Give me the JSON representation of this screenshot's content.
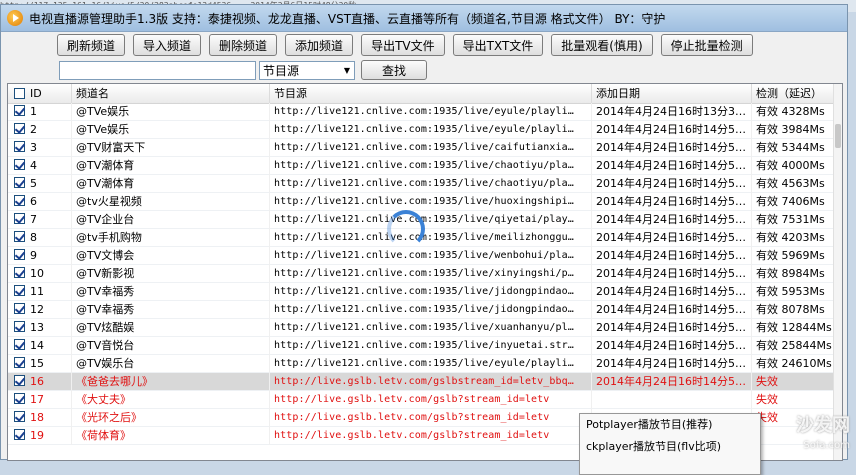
{
  "background_strip": "http://117.135.161.16/live/5/30/283abcefe13d4536... 2014年2月6日15时48分20秒",
  "window": {
    "title": "电视直播源管理助手1.3版  支持：泰捷视频、龙龙直播、VST直播、云直播等所有（频道名,节目源  格式文件） BY：守护"
  },
  "toolbar": {
    "buttons": [
      "刷新频道",
      "导入频道",
      "删除频道",
      "添加频道",
      "导出TV文件",
      "导出TXT文件",
      "批量观看(慎用)",
      "停止批量检测"
    ]
  },
  "search": {
    "value": "",
    "select_value": "节目源",
    "find_label": "查找"
  },
  "table": {
    "columns": [
      "ID",
      "频道名",
      "节目源",
      "添加日期",
      "检测（延迟）"
    ],
    "rows": [
      {
        "checked": true,
        "id": "1",
        "name": "@TVe娱乐",
        "src": "http://live121.cnlive.com:1935/live/eyule/playli…",
        "date": "2014年4月24日16时13分3…",
        "status": "有效  4328Ms",
        "red": false
      },
      {
        "checked": true,
        "id": "2",
        "name": "@TVe娱乐",
        "src": "http://live121.cnlive.com:1935/live/eyule/playli…",
        "date": "2014年4月24日16时14分5…",
        "status": "有效  3984Ms",
        "red": false
      },
      {
        "checked": true,
        "id": "3",
        "name": "@TV财富天下",
        "src": "http://live121.cnlive.com:1935/live/caifutianxia…",
        "date": "2014年4月24日16时14分5…",
        "status": "有效  5344Ms",
        "red": false
      },
      {
        "checked": true,
        "id": "4",
        "name": "@TV潮体育",
        "src": "http://live121.cnlive.com:1935/live/chaotiyu/pla…",
        "date": "2014年4月24日16时14分5…",
        "status": "有效  4000Ms",
        "red": false
      },
      {
        "checked": true,
        "id": "5",
        "name": "@TV潮体育",
        "src": "http://live121.cnlive.com:1935/live/chaotiyu/pla…",
        "date": "2014年4月24日16时14分5…",
        "status": "有效  4563Ms",
        "red": false
      },
      {
        "checked": true,
        "id": "6",
        "name": "@tv火星视频",
        "src": "http://live121.cnlive.com:1935/live/huoxingshipi…",
        "date": "2014年4月24日16时14分5…",
        "status": "有效  7406Ms",
        "red": false
      },
      {
        "checked": true,
        "id": "7",
        "name": "@TV企业台",
        "src": "http://live121.cnlive.com:1935/live/qiyetai/play…",
        "date": "2014年4月24日16时14分5…",
        "status": "有效  7531Ms",
        "red": false
      },
      {
        "checked": true,
        "id": "8",
        "name": "@tv手机购物",
        "src": "http://live121.cnlive.com:1935/live/meilizhonggu…",
        "date": "2014年4月24日16时14分5…",
        "status": "有效  4203Ms",
        "red": false
      },
      {
        "checked": true,
        "id": "9",
        "name": "@TV文博会",
        "src": "http://live121.cnlive.com:1935/live/wenbohui/pla…",
        "date": "2014年4月24日16时14分5…",
        "status": "有效  5969Ms",
        "red": false
      },
      {
        "checked": true,
        "id": "10",
        "name": "@TV新影视",
        "src": "http://live121.cnlive.com:1935/live/xinyingshi/p…",
        "date": "2014年4月24日16时14分5…",
        "status": "有效  8984Ms",
        "red": false
      },
      {
        "checked": true,
        "id": "11",
        "name": "@TV幸福秀",
        "src": "http://live121.cnlive.com:1935/live/jidongpindao…",
        "date": "2014年4月24日16时14分5…",
        "status": "有效  5953Ms",
        "red": false
      },
      {
        "checked": true,
        "id": "12",
        "name": "@TV幸福秀",
        "src": "http://live121.cnlive.com:1935/live/jidongpindao…",
        "date": "2014年4月24日16时14分5…",
        "status": "有效  8078Ms",
        "red": false
      },
      {
        "checked": true,
        "id": "13",
        "name": "@TV炫酷娱",
        "src": "http://live121.cnlive.com:1935/live/xuanhanyu/pl…",
        "date": "2014年4月24日16时14分5…",
        "status": "有效  12844Ms",
        "red": false
      },
      {
        "checked": true,
        "id": "14",
        "name": "@TV音悦台",
        "src": "http://live121.cnlive.com:1935/live/inyuetai.str…",
        "date": "2014年4月24日16时14分5…",
        "status": "有效  25844Ms",
        "red": false
      },
      {
        "checked": true,
        "id": "15",
        "name": "@TV娱乐台",
        "src": "http://live121.cnlive.com:1935/live/eyule/playli…",
        "date": "2014年4月24日16时14分5…",
        "status": "有效  24610Ms",
        "red": false
      },
      {
        "checked": true,
        "id": "16",
        "name": "《爸爸去哪儿》",
        "src": "http://live.gslb.letv.com/gslbstream_id=letv_bbq…",
        "date": "2014年4月24日16时14分5…",
        "status": "失效",
        "red": true
      },
      {
        "checked": true,
        "id": "17",
        "name": "《大丈夫》",
        "src": "http://live.gslb.letv.com/gslb?stream_id=letv",
        "date": "",
        "status": "失效",
        "red": true
      },
      {
        "checked": true,
        "id": "18",
        "name": "《光环之后》",
        "src": "http://live.gslb.letv.com/gslb?stream_id=letv",
        "date": "",
        "status": "失效",
        "red": true
      },
      {
        "checked": true,
        "id": "19",
        "name": "《荷体育》",
        "src": "http://live.gslb.letv.com/gslb?stream_id=letv",
        "date": "",
        "status": "",
        "red": true
      }
    ]
  },
  "context_menu": {
    "items": [
      "Potplayer播放节目(推荐)",
      "ckplayer播放节目(flv比项)"
    ]
  },
  "watermark": {
    "brand": "沙发网",
    "domain": "Sofa.com"
  }
}
